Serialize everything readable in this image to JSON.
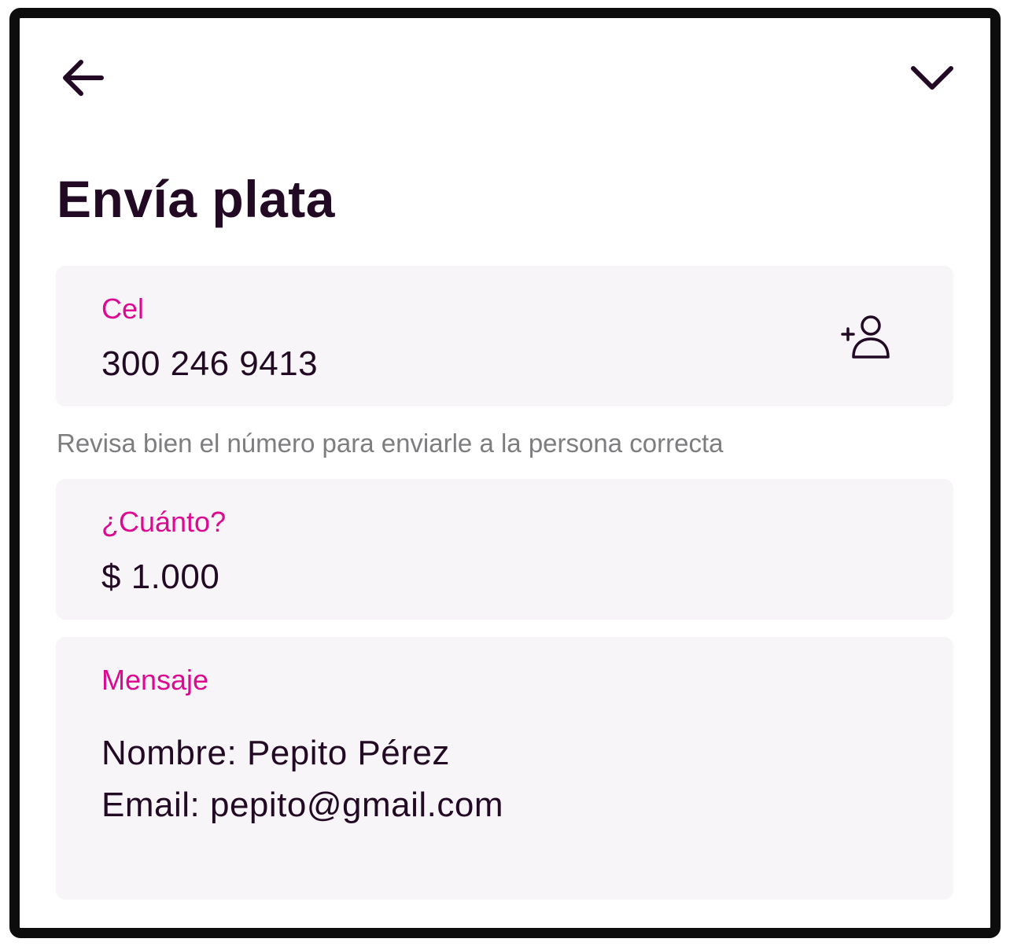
{
  "header": {
    "back_icon": "arrow-left-icon",
    "collapse_icon": "chevron-down-icon"
  },
  "page": {
    "title": "Envía plata"
  },
  "phone": {
    "label": "Cel",
    "value": "300 246 9413",
    "contact_icon": "add-contact-icon",
    "hint": "Revisa bien el número para enviarle a la persona correcta"
  },
  "amount": {
    "label": "¿Cuánto?",
    "value": "$ 1.000"
  },
  "message": {
    "label": "Mensaje",
    "lines": [
      "Nombre: Pepito Pérez",
      "Email: pepito@gmail.com"
    ]
  },
  "colors": {
    "text": "#230a24",
    "accent": "#db0a90",
    "card_bg": "#f7f5f8",
    "hint": "#7d7d80"
  }
}
